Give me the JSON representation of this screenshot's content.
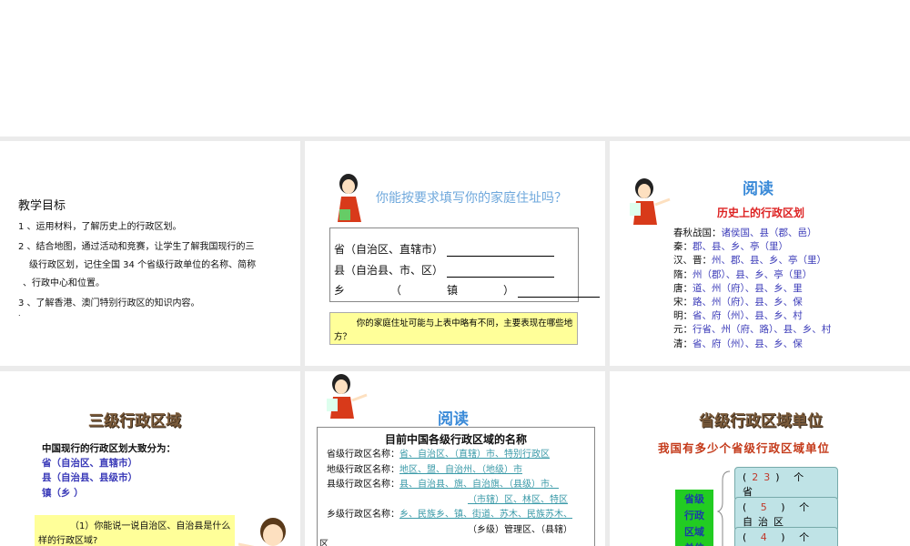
{
  "slide1": {
    "title": "教学目标",
    "items": [
      "1 、运用材料，了解历史上的行政区划。",
      "2 、结合地图，通过活动和竞赛，让学生了解我国现行的三",
      "级行政区划，记住全国 34 个省级行政单位的名称、简称",
      "、行政中心和位置。",
      "3 、了解香港、澳门特别行政区的知识内容。"
    ],
    "dot": "."
  },
  "slide2": {
    "title": "你能按要求填写你的家庭住址吗？",
    "rows": [
      "省（自治区、直辖市）",
      "县（自治县、市、区）"
    ],
    "row3": {
      "a": "乡",
      "b": "（",
      "c": "镇",
      "d": "）"
    },
    "note": "你的家庭住址可能与上表中略有不同，主要表现在哪些地方？"
  },
  "slide3": {
    "title": "阅读",
    "subtitle": "历史上的行政区划",
    "rows": [
      {
        "k": "春秋战国：",
        "v": "诸侯国、县（郡、邑）"
      },
      {
        "k": "秦：",
        "v": "郡、县、乡、亭（里）"
      },
      {
        "k": "汉、晋：",
        "v": "州、郡、县、乡、亭（里）"
      },
      {
        "k": "隋：",
        "v": "州（郡）、县、乡、亭（里）"
      },
      {
        "k": "唐：",
        "v": "道、州（府）、县、乡、里"
      },
      {
        "k": "宋：",
        "v": "路、州（府）、县、乡、保"
      },
      {
        "k": "明：",
        "v": "省、府（州）、县、乡、村"
      },
      {
        "k": "元：",
        "v": "行省、州（府、路）、县、乡、村"
      },
      {
        "k": "清：",
        "v": "省、府（州）、县、乡、保"
      }
    ]
  },
  "slide4": {
    "title": "三级行政区域",
    "intro": "中国现行的行政区划大致分为：",
    "levels": [
      "省（自治区、直辖市）",
      "县（自治县、县级市）",
      "镇（乡 ）"
    ],
    "question": "（1）你能说一说自治区、自治县是什么样的行政区域?"
  },
  "slide5": {
    "title": "阅读",
    "box_title": "目前中国各级行政区域的名称",
    "rows": [
      {
        "k": "省级行政区名称：",
        "v": "省、自治区、（直辖）市、特别行政区"
      },
      {
        "k": "地级行政区名称：",
        "v": "地区、盟、自治州、（地级）市"
      },
      {
        "k": "县级行政区名称：",
        "v": "县、自治县、旗、自治旗、（县级）市、"
      },
      {
        "k": "",
        "v": "（市辖）区、林区、特区"
      },
      {
        "k": "乡级行政区名称：",
        "v": "乡、民族乡、镇、街道、苏木、民族苏木、"
      },
      {
        "k": "",
        "v": "（乡级）管理区、（县辖）"
      },
      {
        "k": "",
        "v": "区"
      }
    ]
  },
  "slide6": {
    "title": "省级行政区域单位",
    "question": "我国有多少个省级行政区域单位",
    "side_label": [
      "省级",
      "行政",
      "区域",
      "单位"
    ],
    "items": [
      {
        "n": "23",
        "label": "个　省"
      },
      {
        "n": "5",
        "label": "个自治区"
      },
      {
        "n": "4",
        "label": "个直辖市"
      }
    ]
  }
}
